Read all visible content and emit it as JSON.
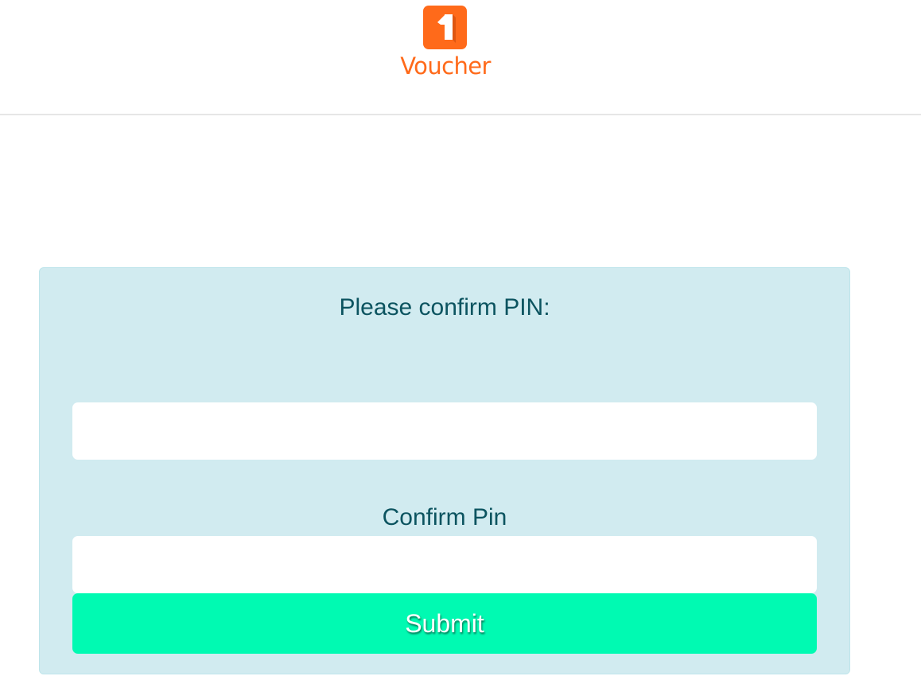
{
  "header": {
    "brand_name": "Voucher",
    "logo_icon": "voucher-logo-mark",
    "brand_color": "#ff6a1a"
  },
  "panel": {
    "title": "Please confirm PIN:",
    "pin_field": {
      "value": "",
      "placeholder": ""
    },
    "confirm_label": "Confirm Pin",
    "confirm_field": {
      "value": "",
      "placeholder": ""
    },
    "submit_label": "Submit",
    "panel_color": "#d1ebf0",
    "text_color": "#0c5460",
    "submit_color": "#00fab2"
  }
}
